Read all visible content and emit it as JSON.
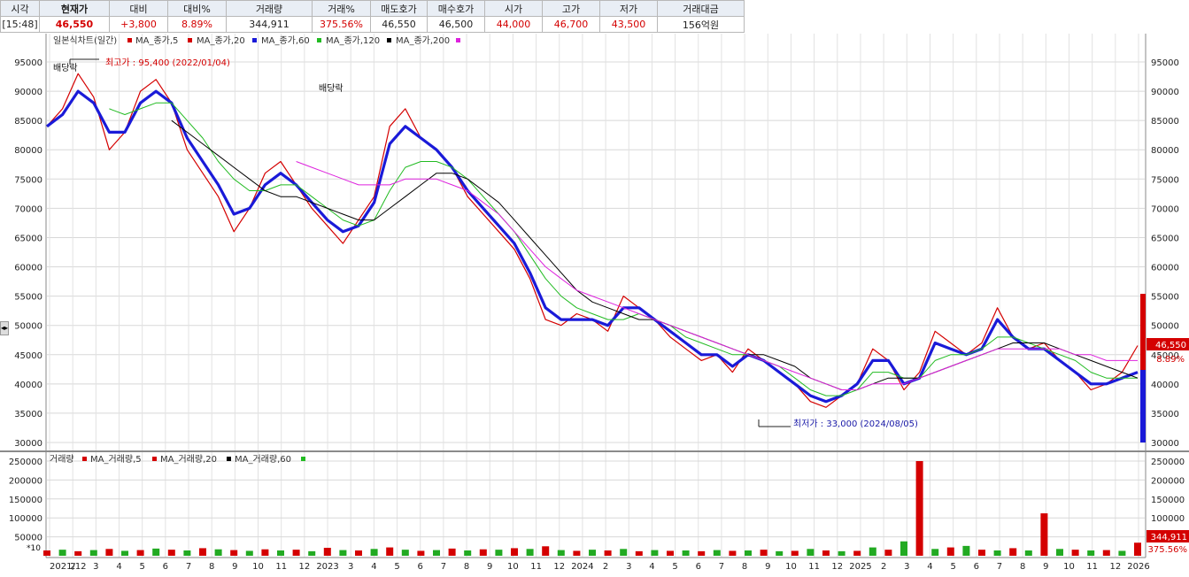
{
  "quote_bar": {
    "columns": [
      {
        "header": "시각",
        "value": "[15:48]",
        "color": "#222222",
        "bold": false
      },
      {
        "header": "현재가",
        "value": "46,550",
        "color": "#d40000",
        "bold": true
      },
      {
        "header": "대비",
        "value": "+3,800",
        "color": "#d40000",
        "bold": false
      },
      {
        "header": "대비%",
        "value": "8.89%",
        "color": "#d40000",
        "bold": false
      },
      {
        "header": "거래량",
        "value": "344,911",
        "color": "#222222",
        "bold": false
      },
      {
        "header": "거래%",
        "value": "375.56%",
        "color": "#d40000",
        "bold": false
      },
      {
        "header": "매도호가",
        "value": "46,550",
        "color": "#222222",
        "bold": false
      },
      {
        "header": "매수호가",
        "value": "46,500",
        "color": "#222222",
        "bold": false
      },
      {
        "header": "시가",
        "value": "44,000",
        "color": "#d40000",
        "bold": false
      },
      {
        "header": "고가",
        "value": "46,700",
        "color": "#d40000",
        "bold": false
      },
      {
        "header": "저가",
        "value": "43,500",
        "color": "#d40000",
        "bold": false
      },
      {
        "header": "거래대금",
        "value": "156억원",
        "color": "#222222",
        "bold": false
      }
    ]
  },
  "price_chart": {
    "legend": [
      {
        "text": "일본식차트(일간)",
        "color": "#d40000"
      },
      {
        "text": "MA_종가,5",
        "color": "#d40000"
      },
      {
        "text": "MA_종가,20",
        "color": "#1a1ad8"
      },
      {
        "text": "MA_종가,60",
        "color": "#22bb22"
      },
      {
        "text": "MA_종가,120",
        "color": "#000000"
      },
      {
        "text": "MA_종가,200",
        "color": "#dd22dd"
      }
    ],
    "annotations": {
      "high_label": "최고가 : 95,400 (2022/01/04)",
      "low_label": "최저가 : 33,000 (2024/08/05)",
      "dividend_1": "배당락",
      "dividend_2": "배당락"
    },
    "current_price_label": "46,550",
    "current_pct_label": "8.89%"
  },
  "volume_chart": {
    "legend": [
      {
        "text": "거래량",
        "color": "#d40000"
      },
      {
        "text": "MA_거래량,5",
        "color": "#d40000"
      },
      {
        "text": "MA_거래량,20",
        "color": "#000000"
      },
      {
        "text": "MA_거래량,60",
        "color": "#22bb22"
      }
    ],
    "scale_label": "*10",
    "current_volume_label": "344,911",
    "current_volume_pct_label": "375.56%"
  },
  "x_axis_labels": [
    "2021/12",
    "2",
    "3",
    "4",
    "5",
    "6",
    "7",
    "8",
    "9",
    "10",
    "11",
    "12",
    "2023",
    "3",
    "4",
    "5",
    "6",
    "7",
    "8",
    "9",
    "10",
    "11",
    "12",
    "2024",
    "2",
    "3",
    "4",
    "5",
    "6",
    "7",
    "8",
    "9",
    "10",
    "11",
    "12",
    "2025",
    "2",
    "3",
    "4",
    "5",
    "6",
    "7",
    "8",
    "9",
    "10",
    "11",
    "12",
    "2026"
  ],
  "chart_data": [
    {
      "type": "line",
      "title": "일본식차트(일간)",
      "ylim": [
        30000,
        95000
      ],
      "y_ticks": [
        "30000",
        "35000",
        "40000",
        "45000",
        "50000",
        "55000",
        "60000",
        "65000",
        "70000",
        "75000",
        "80000",
        "85000",
        "90000",
        "95000"
      ],
      "x_labels": [
        "2021/12",
        "2",
        "3",
        "4",
        "5",
        "6",
        "7",
        "8",
        "9",
        "10",
        "11",
        "12",
        "2023",
        "3",
        "4",
        "5",
        "6",
        "7",
        "8",
        "9",
        "10",
        "11",
        "12",
        "2024",
        "2",
        "3",
        "4",
        "5",
        "6",
        "7",
        "8",
        "9",
        "10",
        "11",
        "12",
        "2025",
        "2",
        "3",
        "4",
        "5",
        "6",
        "7",
        "8",
        "9",
        "10",
        "11",
        "12",
        "2026"
      ],
      "series": [
        {
          "name": "MA_종가,5",
          "values": [
            84000,
            87000,
            93000,
            89000,
            80000,
            83000,
            90000,
            92000,
            88000,
            80000,
            76000,
            72000,
            66000,
            70000,
            76000,
            78000,
            74000,
            70000,
            67000,
            64000,
            68000,
            72000,
            84000,
            87000,
            82000,
            80000,
            77000,
            72000,
            69000,
            66000,
            63000,
            58000,
            51000,
            50000,
            52000,
            51000,
            49000,
            55000,
            53000,
            51000,
            48000,
            46000,
            44000,
            45000,
            42000,
            46000,
            44000,
            42000,
            40000,
            37000,
            36000,
            38000,
            40000,
            46000,
            44000,
            39000,
            42000,
            49000,
            47000,
            45000,
            47000,
            53000,
            48000,
            46000,
            47000,
            44000,
            42000,
            39000,
            40000,
            42000,
            46550
          ]
        },
        {
          "name": "MA_종가,20",
          "values": [
            84000,
            86000,
            90000,
            88000,
            83000,
            83000,
            88000,
            90000,
            88000,
            82000,
            78000,
            74000,
            69000,
            70000,
            74000,
            76000,
            74000,
            71000,
            68000,
            66000,
            67000,
            71000,
            81000,
            84000,
            82000,
            80000,
            77000,
            73000,
            70000,
            67000,
            64000,
            59000,
            53000,
            51000,
            51000,
            51000,
            50000,
            53000,
            53000,
            51000,
            49000,
            47000,
            45000,
            45000,
            43000,
            45000,
            44000,
            42000,
            40000,
            38000,
            37000,
            38000,
            40000,
            44000,
            44000,
            40000,
            41000,
            47000,
            46000,
            45000,
            46000,
            51000,
            48000,
            46000,
            46000,
            44000,
            42000,
            40000,
            40000,
            41000,
            42000
          ]
        },
        {
          "name": "MA_종가,60",
          "values": [
            null,
            null,
            null,
            null,
            87000,
            86000,
            87000,
            88000,
            88000,
            85000,
            82000,
            78000,
            75000,
            73000,
            73000,
            74000,
            74000,
            72000,
            70000,
            68000,
            67000,
            68000,
            73000,
            77000,
            78000,
            78000,
            77000,
            75000,
            72000,
            69000,
            66000,
            62000,
            58000,
            55000,
            53000,
            52000,
            51000,
            51000,
            52000,
            51000,
            50000,
            48000,
            47000,
            46000,
            45000,
            45000,
            44000,
            43000,
            41000,
            39000,
            38000,
            38000,
            39000,
            42000,
            42000,
            41000,
            41000,
            44000,
            45000,
            45000,
            46000,
            48000,
            48000,
            47000,
            46000,
            45000,
            44000,
            42000,
            41000,
            41000,
            41000
          ]
        },
        {
          "name": "MA_종가,120",
          "values": [
            null,
            null,
            null,
            null,
            null,
            null,
            null,
            null,
            85000,
            83000,
            81000,
            79000,
            77000,
            75000,
            73000,
            72000,
            72000,
            71000,
            70000,
            69000,
            68000,
            68000,
            70000,
            72000,
            74000,
            76000,
            76000,
            75000,
            73000,
            71000,
            68000,
            65000,
            62000,
            59000,
            56000,
            54000,
            53000,
            52000,
            51000,
            51000,
            50000,
            49000,
            48000,
            47000,
            46000,
            45000,
            45000,
            44000,
            43000,
            41000,
            40000,
            39000,
            39000,
            40000,
            41000,
            41000,
            41000,
            42000,
            43000,
            44000,
            45000,
            46000,
            47000,
            47000,
            47000,
            46000,
            45000,
            44000,
            43000,
            42000,
            41000
          ]
        },
        {
          "name": "MA_종가,200",
          "values": [
            null,
            null,
            null,
            null,
            null,
            null,
            null,
            null,
            null,
            null,
            null,
            null,
            null,
            null,
            null,
            null,
            78000,
            77000,
            76000,
            75000,
            74000,
            74000,
            74000,
            75000,
            75000,
            75000,
            74000,
            73000,
            71000,
            69000,
            66000,
            63000,
            60000,
            58000,
            56000,
            55000,
            54000,
            53000,
            52000,
            51000,
            50000,
            49000,
            48000,
            47000,
            46000,
            45000,
            44000,
            43000,
            42000,
            41000,
            40000,
            39000,
            39000,
            40000,
            40000,
            40000,
            41000,
            42000,
            43000,
            44000,
            45000,
            46000,
            46000,
            46000,
            46000,
            46000,
            45000,
            45000,
            44000,
            44000,
            44000
          ]
        }
      ]
    },
    {
      "type": "bar",
      "title": "거래량",
      "ylim": [
        0,
        250000
      ],
      "y_ticks": [
        "50000",
        "100000",
        "150000",
        "200000",
        "250000"
      ],
      "x_labels": [
        "2021/12",
        "2",
        "3",
        "4",
        "5",
        "6",
        "7",
        "8",
        "9",
        "10",
        "11",
        "12",
        "2023",
        "3",
        "4",
        "5",
        "6",
        "7",
        "8",
        "9",
        "10",
        "11",
        "12",
        "2024",
        "2",
        "3",
        "4",
        "5",
        "6",
        "7",
        "8",
        "9",
        "10",
        "11",
        "12",
        "2025",
        "2",
        "3",
        "4",
        "5",
        "6",
        "7",
        "8",
        "9",
        "10",
        "11",
        "12",
        "2026"
      ],
      "series": [
        {
          "name": "거래량",
          "values": [
            14000,
            16000,
            12000,
            15000,
            18000,
            13000,
            15000,
            19000,
            16000,
            14000,
            20000,
            17000,
            15000,
            13000,
            17000,
            14000,
            16000,
            12000,
            21000,
            15000,
            14000,
            18000,
            22000,
            16000,
            13000,
            15000,
            19000,
            14000,
            17000,
            16000,
            20000,
            18000,
            25000,
            15000,
            13000,
            16000,
            14000,
            18000,
            12000,
            15000,
            13000,
            14000,
            12000,
            15000,
            13000,
            14000,
            16000,
            12000,
            13000,
            18000,
            14000,
            12000,
            13000,
            22000,
            16000,
            38000,
            250000,
            18000,
            22000,
            26000,
            16000,
            14000,
            20000,
            14000,
            112000,
            18000,
            16000,
            14000,
            15000,
            13000,
            34491
          ]
        }
      ]
    }
  ]
}
